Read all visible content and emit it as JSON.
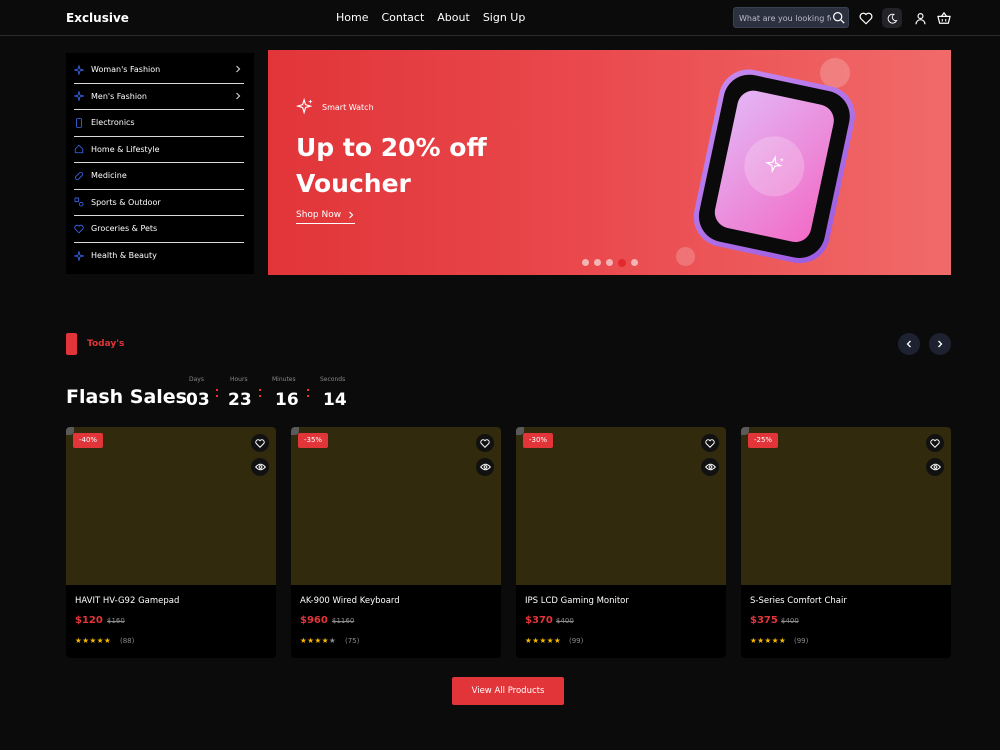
{
  "header": {
    "logo": "Exclusive",
    "nav": [
      "Home",
      "Contact",
      "About",
      "Sign Up"
    ],
    "search_placeholder": "What are you looking for?"
  },
  "sidebar": {
    "items": [
      {
        "label": "Woman's Fashion",
        "icon": "sparkle-icon",
        "has_submenu": true
      },
      {
        "label": "Men's Fashion",
        "icon": "sparkle-icon",
        "has_submenu": true
      },
      {
        "label": "Electronics",
        "icon": "phone-icon",
        "has_submenu": false
      },
      {
        "label": "Home & Lifestyle",
        "icon": "home-icon",
        "has_submenu": false
      },
      {
        "label": "Medicine",
        "icon": "pill-icon",
        "has_submenu": false
      },
      {
        "label": "Sports & Outdoor",
        "icon": "sports-icon",
        "has_submenu": false
      },
      {
        "label": "Groceries & Pets",
        "icon": "heart-icon",
        "has_submenu": false
      },
      {
        "label": "Health & Beauty",
        "icon": "sparkle-icon",
        "has_submenu": false
      }
    ]
  },
  "banner": {
    "subtitle": "Smart Watch",
    "title": "Up to 20% off Voucher",
    "cta": "Shop Now",
    "slide_count": 5,
    "active_slide": 4
  },
  "section": {
    "tag": "Today's",
    "title": "Flash Sales",
    "countdown": [
      {
        "label": "Days",
        "value": "03"
      },
      {
        "label": "Hours",
        "value": "23"
      },
      {
        "label": "Minutes",
        "value": "16"
      },
      {
        "label": "Seconds",
        "value": "14"
      }
    ]
  },
  "products": [
    {
      "discount": "-40%",
      "name": "HAVIT HV-G92 Gamepad",
      "price": "$120",
      "old_price": "$160",
      "rating": 5,
      "reviews": "(88)"
    },
    {
      "discount": "-35%",
      "name": "AK-900 Wired Keyboard",
      "price": "$960",
      "old_price": "$1160",
      "rating": 4,
      "reviews": "(75)"
    },
    {
      "discount": "-30%",
      "name": "IPS LCD Gaming Monitor",
      "price": "$370",
      "old_price": "$400",
      "rating": 5,
      "reviews": "(99)"
    },
    {
      "discount": "-25%",
      "name": "S-Series Comfort Chair",
      "price": "$375",
      "old_price": "$400",
      "rating": 5,
      "reviews": "(99)"
    }
  ],
  "view_all_label": "View All Products",
  "colors": {
    "accent": "#e13539",
    "background": "#0c0b0b",
    "card_image": "#312a0c"
  }
}
